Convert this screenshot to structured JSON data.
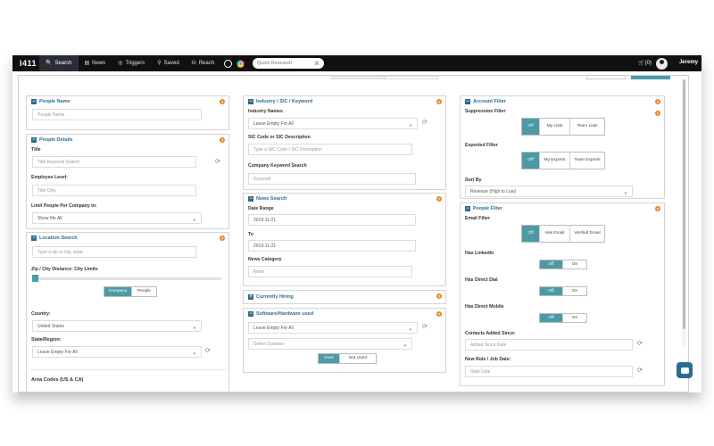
{
  "app": {
    "logo": "I411",
    "user": "Jeremy",
    "cart": "🛒(0)"
  },
  "nav": [
    {
      "label": "Search",
      "icon": "search-icon",
      "glyph": "🔍",
      "active": true
    },
    {
      "label": "News",
      "icon": "news-icon",
      "glyph": "▤"
    },
    {
      "label": "Triggers",
      "icon": "target-icon",
      "glyph": "◎"
    },
    {
      "label": "Saved",
      "icon": "saved-icon",
      "glyph": "⚲"
    },
    {
      "label": "Reach",
      "icon": "reach-icon",
      "glyph": "⛁"
    }
  ],
  "quick_search": {
    "placeholder": "Quick Research",
    "clear": "⌘"
  },
  "people_name": {
    "title": "People Name",
    "placeholder": "People Name"
  },
  "people_details": {
    "title": "People Details",
    "title_label": "Title",
    "title_placeholder": "Title Keyword Search",
    "employee_level_label": "Employee Level:",
    "employee_level_placeholder": "Title Only",
    "limit_label": "Limit People Per Company to:",
    "limit_value": "Show Me All"
  },
  "location": {
    "title": "Location Search",
    "zip_placeholder": "Type a zip or city, state",
    "distance_label": "Zip / City Distance: City Limits",
    "toggle": [
      "Company",
      "People"
    ],
    "country_label": "Country:",
    "country_value": "United States",
    "state_label": "State/Region:",
    "state_value": "Leave Empty For All",
    "area_codes_label": "Area Codes (US & CA)"
  },
  "industry": {
    "title": "Industry / SIC / Keyword",
    "names_label": "Industry Names",
    "names_value": "Leave Empty For All",
    "sic_label": "SIC Code or SIC Description",
    "sic_placeholder": "Type a SIC Code / SIC Description",
    "keyword_label": "Company Keyword Search",
    "keyword_placeholder": "Keyword"
  },
  "news": {
    "title": "News Search",
    "date_range_label": "Date Range",
    "from_value": "2019-11-21",
    "to_label": "To",
    "to_value": "2019-11-21",
    "category_label": "News Category",
    "category_placeholder": "News"
  },
  "currently_hiring": {
    "title": "Currently Hiring"
  },
  "software": {
    "title": "Software/Hardware used",
    "value": "Leave Empty For All",
    "duration_placeholder": "Select Duration",
    "toggle": [
      "Uses",
      "Not Used"
    ]
  },
  "account_filter": {
    "title": "Account Filter",
    "suppression_label": "Suppression Filter",
    "suppression_options": [
      "Off",
      "My Lists",
      "Team Lists"
    ],
    "exported_label": "Exported Filter",
    "exported_options": [
      "Off",
      "My Exports",
      "Team Exports"
    ],
    "sort_label": "Sort By",
    "sort_value": "Revenue (High to Low)"
  },
  "people_filter": {
    "title": "People Filter",
    "email_label": "Email Filter",
    "email_options": [
      "Off",
      "Has Email",
      "Verified Email"
    ],
    "linkedin_label": "Has LinkedIn",
    "direct_dial_label": "Has Direct Dial",
    "direct_mobile_label": "Has Direct Mobile",
    "off_on": [
      "Off",
      "On"
    ],
    "contacts_added_label": "Contacts Added Since:",
    "contacts_added_placeholder": "Added Since Date",
    "new_role_label": "New Role / Job Date:",
    "new_role_placeholder": "Start Date"
  },
  "help_glyph": "?",
  "minus_glyph": "−",
  "plus_glyph": "+",
  "refresh_glyph": "⟳",
  "caret_glyph": "▼"
}
